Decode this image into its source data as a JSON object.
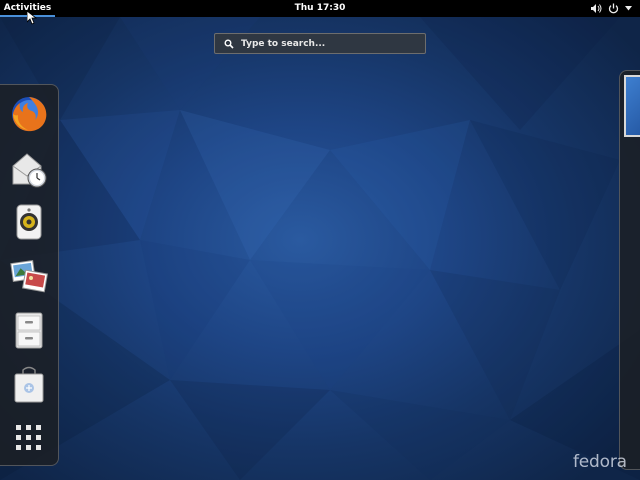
{
  "topbar": {
    "activities_label": "Activities",
    "clock": "Thu 17:30",
    "status_icons": [
      "volume-icon",
      "power-icon",
      "menu-arrow-icon"
    ]
  },
  "search": {
    "placeholder": "Type to search..."
  },
  "dash": {
    "items": [
      {
        "name": "firefox",
        "icon": "firefox-icon"
      },
      {
        "name": "evolution",
        "icon": "mail-clock-icon"
      },
      {
        "name": "rhythmbox",
        "icon": "speaker-icon"
      },
      {
        "name": "shotwell",
        "icon": "photos-icon"
      },
      {
        "name": "files",
        "icon": "file-cabinet-icon"
      },
      {
        "name": "software",
        "icon": "shopping-bag-icon"
      },
      {
        "name": "show-applications",
        "icon": "app-grid-icon"
      }
    ]
  },
  "workspaces": {
    "count_visible": 1
  },
  "branding": {
    "logo_text": "fedora"
  },
  "colors": {
    "topbar": "#000000",
    "accent": "#4a90d9",
    "wallpaper": "#1e4585"
  }
}
